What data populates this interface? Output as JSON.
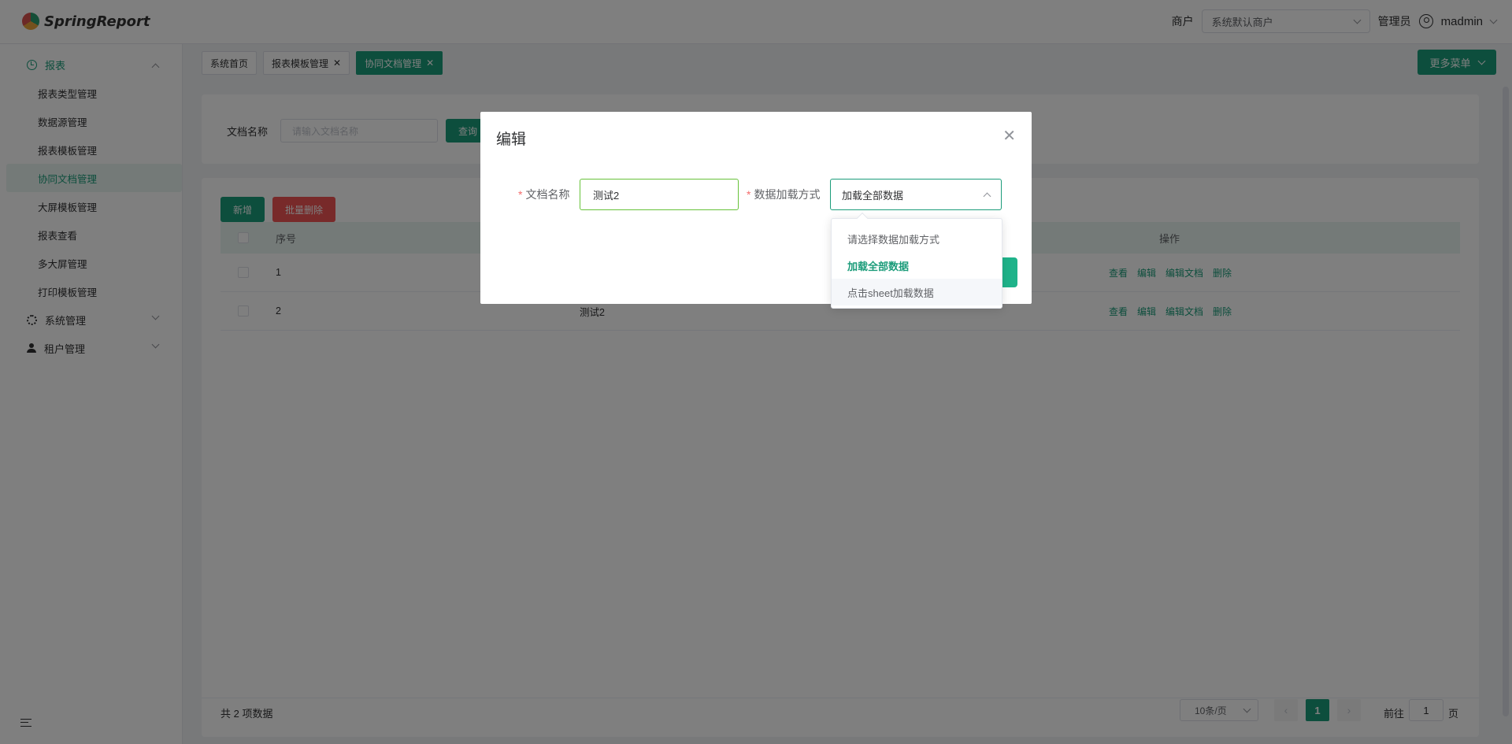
{
  "header": {
    "brand": "SpringReport",
    "tenant_label": "商户",
    "tenant_value": "系统默认商户",
    "role": "管理员",
    "username": "madmin"
  },
  "sidebar": {
    "groups": [
      {
        "label": "报表",
        "items": [
          "报表类型管理",
          "数据源管理",
          "报表模板管理",
          "协同文档管理",
          "大屏模板管理",
          "报表查看",
          "多大屏管理",
          "打印模板管理"
        ]
      },
      {
        "label": "系统管理"
      },
      {
        "label": "租户管理"
      }
    ],
    "active_item": "协同文档管理"
  },
  "tabs": [
    {
      "label": "系统首页",
      "closable": false
    },
    {
      "label": "报表模板管理",
      "closable": true
    },
    {
      "label": "协同文档管理",
      "closable": true,
      "active": true
    }
  ],
  "more_menu": "更多菜单",
  "search": {
    "label": "文档名称",
    "placeholder": "请输入文档名称",
    "button": "查询"
  },
  "toolbar": {
    "add": "新增",
    "batch_delete": "批量删除"
  },
  "table": {
    "headers": {
      "index": "序号",
      "ops": "操作"
    },
    "rows": [
      {
        "index": "1",
        "name": ""
      },
      {
        "index": "2",
        "name": "测试2"
      }
    ],
    "ops": [
      "查看",
      "编辑",
      "编辑文档",
      "删除"
    ]
  },
  "pagination": {
    "total": "共 2 项数据",
    "page_size": "10条/页",
    "current": "1",
    "goto_prefix": "前往",
    "goto_value": "1",
    "goto_suffix": "页"
  },
  "dialog": {
    "title": "编辑",
    "name_label": "文档名称",
    "name_value": "测试2",
    "mode_label": "数据加载方式",
    "mode_value": "加载全部数据",
    "options": [
      "请选择数据加载方式",
      "加载全部数据",
      "点击sheet加载数据"
    ],
    "selected_option": "加载全部数据"
  },
  "colors": {
    "primary": "#1b9c7a",
    "danger": "#f05454"
  }
}
